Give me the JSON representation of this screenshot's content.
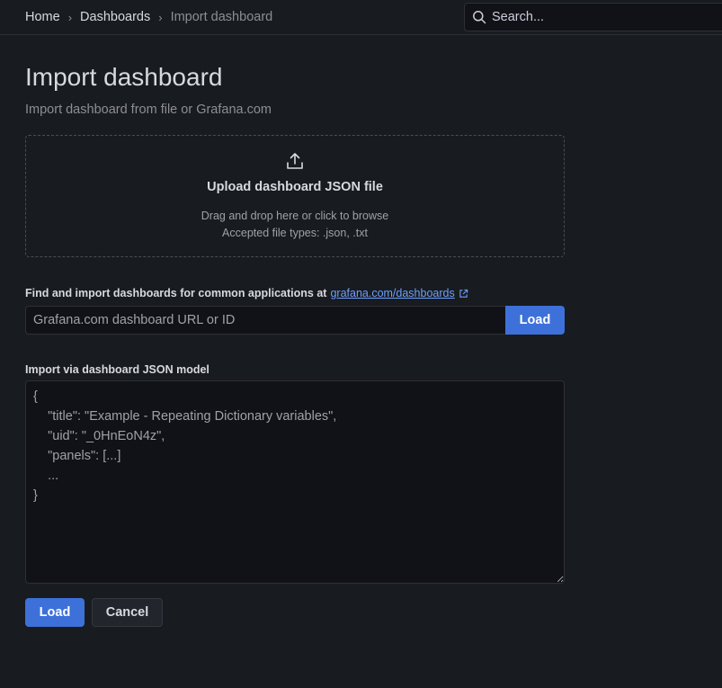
{
  "breadcrumb": {
    "home": "Home",
    "dashboards": "Dashboards",
    "current": "Import dashboard",
    "separator": "›"
  },
  "search": {
    "placeholder": "Search..."
  },
  "page": {
    "title": "Import dashboard",
    "subtitle": "Import dashboard from file or Grafana.com"
  },
  "upload": {
    "title": "Upload dashboard JSON file",
    "hint": "Drag and drop here or click to browse",
    "accepted": "Accepted file types: .json, .txt"
  },
  "grafana_com": {
    "label": "Find and import dashboards for common applications at",
    "link_text": "grafana.com/dashboards",
    "input_placeholder": "Grafana.com dashboard URL or ID",
    "input_value": "",
    "load_label": "Load"
  },
  "json_model": {
    "label": "Import via dashboard JSON model",
    "placeholder": "{\n    \"title\": \"Example - Repeating Dictionary variables\",\n    \"uid\": \"_0HnEoN4z\",\n    \"panels\": [...]\n    ...\n}",
    "value": ""
  },
  "actions": {
    "load_label": "Load",
    "cancel_label": "Cancel"
  },
  "icons": {
    "search": "search-icon",
    "upload": "upload-icon",
    "external_link": "external-link-icon"
  },
  "colors": {
    "background": "#181b1f",
    "primary": "#3d71d9",
    "link": "#6e9fff",
    "input_bg": "#111217"
  }
}
